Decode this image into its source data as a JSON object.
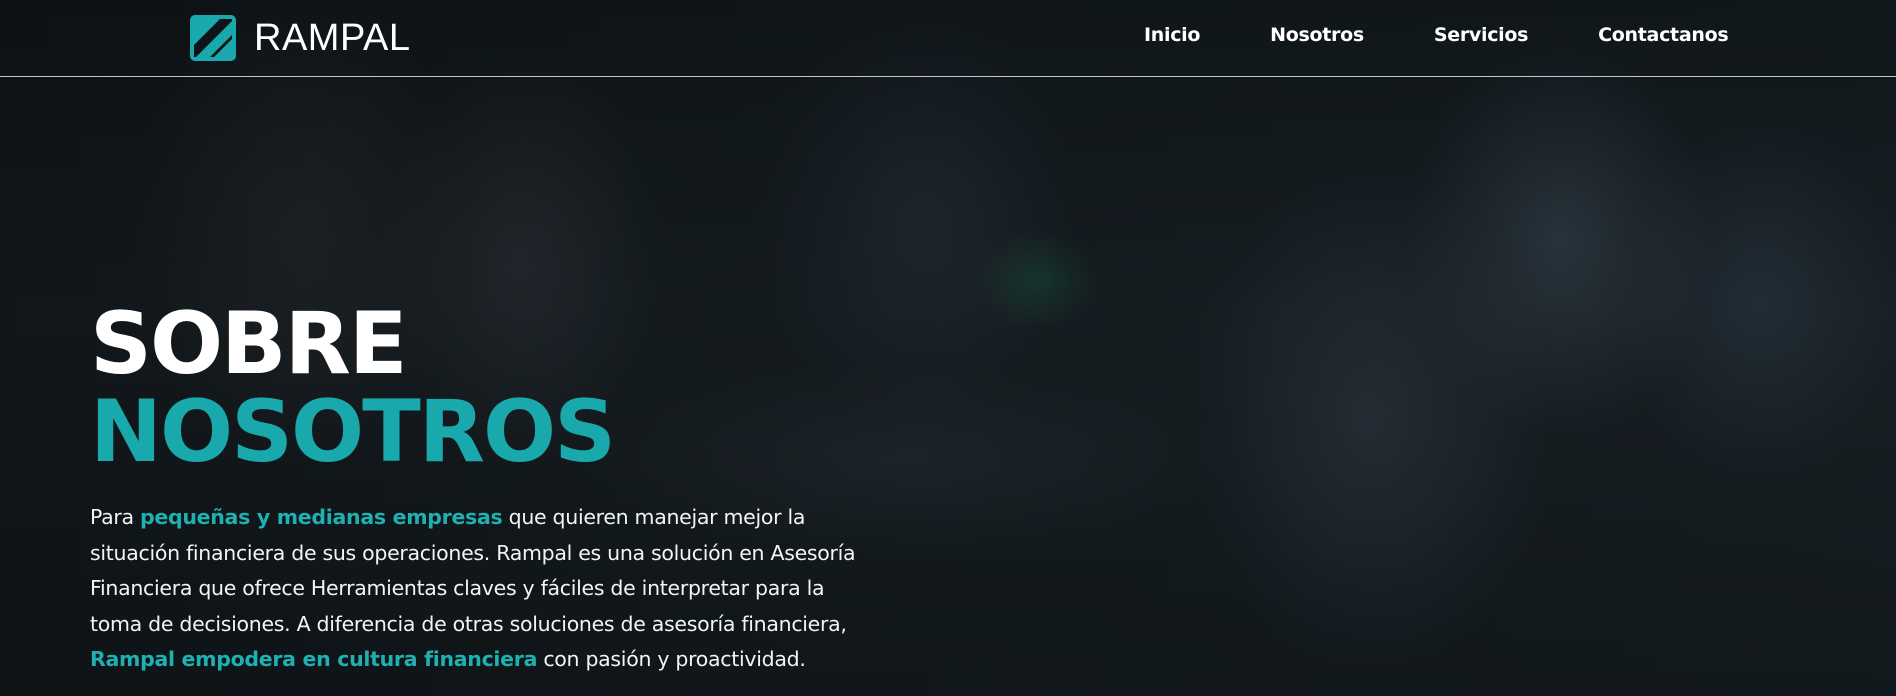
{
  "brand": {
    "name": "RAMPAL",
    "logo_icon": "rampal-logo-icon",
    "accent_color": "#19a8ab"
  },
  "nav": {
    "items": [
      {
        "label": "Inicio"
      },
      {
        "label": "Nosotros"
      },
      {
        "label": "Servicios"
      },
      {
        "label": "Contactanos"
      }
    ]
  },
  "hero": {
    "title_line1": "SOBRE",
    "title_line2": "NOSOTROS",
    "desc_1": "Para ",
    "desc_hl_1": "pequeñas y medianas empresas",
    "desc_2": " que quieren manejar mejor la situación financiera de sus operaciones. Rampal es una solución en Asesoría Financiera que ofrece Herramientas claves y fáciles de interpretar para la toma de decisiones. A diferencia de otras soluciones de asesoría financiera, ",
    "desc_hl_2": "Rampal empodera en cultura financiera",
    "desc_3": " con pasión y proactividad."
  }
}
